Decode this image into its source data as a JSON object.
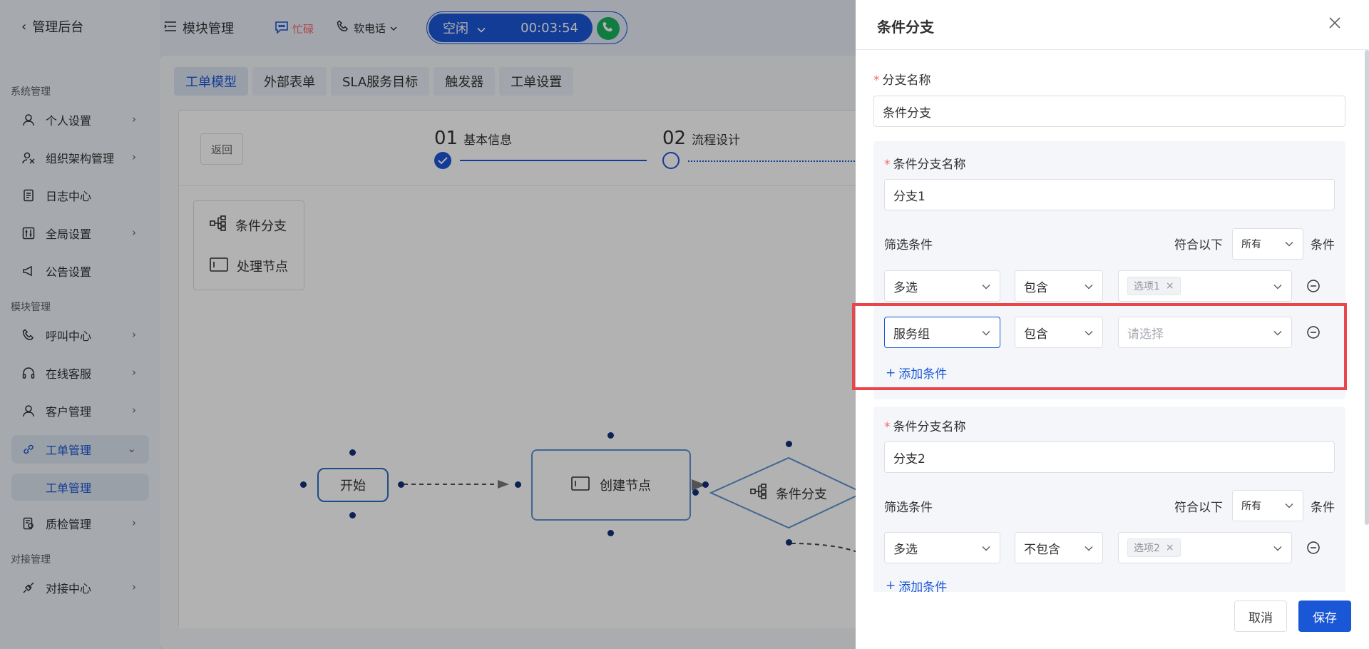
{
  "sidebar": {
    "back_label": "管理后台",
    "sections": [
      "系统管理",
      "模块管理",
      "对接管理"
    ],
    "items": [
      {
        "label": "个人设置",
        "icon": "user-icon"
      },
      {
        "label": "组织架构管理",
        "icon": "org-icon"
      },
      {
        "label": "日志中心",
        "icon": "log-icon"
      },
      {
        "label": "全局设置",
        "icon": "sliders-icon"
      },
      {
        "label": "公告设置",
        "icon": "megaphone-icon"
      },
      {
        "label": "呼叫中心",
        "icon": "phone-icon"
      },
      {
        "label": "在线客服",
        "icon": "headset-icon"
      },
      {
        "label": "客户管理",
        "icon": "user-icon"
      },
      {
        "label": "工单管理",
        "icon": "link-icon"
      },
      {
        "label": "质检管理",
        "icon": "doc-search-icon"
      },
      {
        "label": "对接中心",
        "icon": "plug-icon"
      }
    ],
    "sub_item": "工单管理"
  },
  "topbar": {
    "module_label": "模块管理",
    "busy_label": "忙碌",
    "softphone_label": "软电话",
    "status_label": "空闲",
    "timer": "00:03:54"
  },
  "tabs": [
    "工单模型",
    "外部表单",
    "SLA服务目标",
    "触发器",
    "工单设置"
  ],
  "steps": {
    "back_button": "返回",
    "step1_num": "01",
    "step1_label": "基本信息",
    "step2_num": "02",
    "step2_label": "流程设计"
  },
  "palette": [
    "条件分支",
    "处理节点"
  ],
  "canvas": {
    "start_node": "开始",
    "create_node": "创建节点",
    "branch_node": "条件分支"
  },
  "drawer": {
    "title": "条件分支",
    "branch_name_label": "分支名称",
    "branch_name_value": "条件分支",
    "cond_branch_label": "条件分支名称",
    "filter_label": "筛选条件",
    "match_prefix": "符合以下",
    "match_suffix": "条件",
    "add_condition": "添加条件",
    "branches": [
      {
        "name": "分支1",
        "match": "所有",
        "conditions": [
          {
            "field": "多选",
            "op": "包含",
            "tag": "选项1",
            "placeholder": ""
          },
          {
            "field": "服务组",
            "op": "包含",
            "tag": "",
            "placeholder": "请选择"
          }
        ]
      },
      {
        "name": "分支2",
        "match": "所有",
        "conditions": [
          {
            "field": "多选",
            "op": "不包含",
            "tag": "选项2",
            "placeholder": ""
          }
        ]
      }
    ],
    "cancel_label": "取消",
    "save_label": "保存"
  },
  "colors": {
    "primary": "#1a57d6",
    "danger": "#e8464b",
    "success": "#19b25f"
  }
}
